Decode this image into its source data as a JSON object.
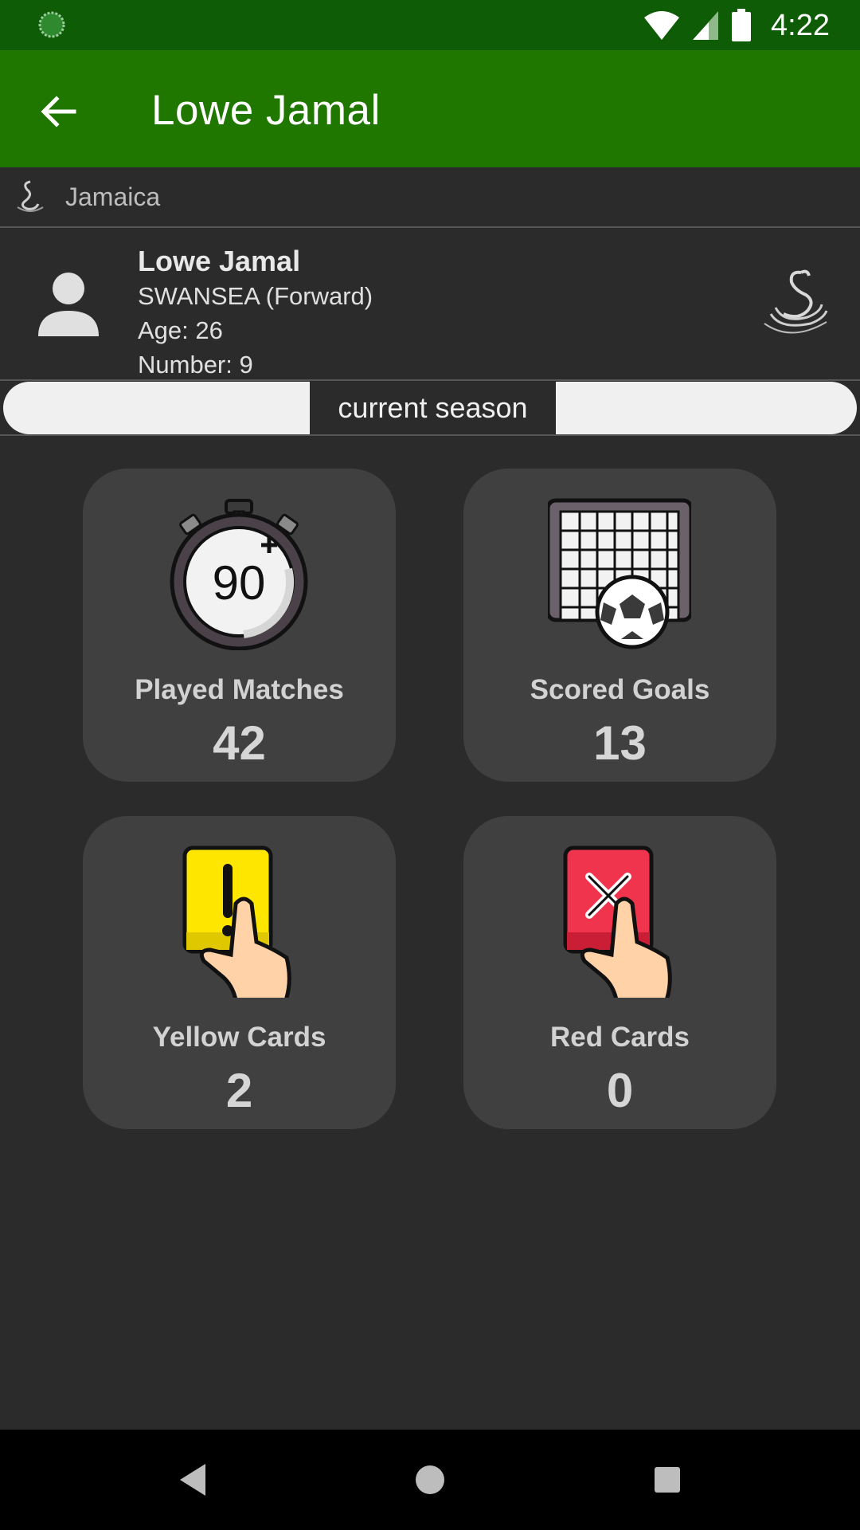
{
  "status_bar": {
    "time": "4:22",
    "icons": [
      "loading-icon",
      "wifi-icon",
      "signal-icon",
      "battery-icon"
    ]
  },
  "app_bar": {
    "title": "Lowe Jamal",
    "back_icon": "arrow-back-icon"
  },
  "country": {
    "name": "Jamaica",
    "icon": "swansea-badge-icon"
  },
  "player": {
    "name": "Lowe Jamal",
    "club_position": "SWANSEA  (Forward)",
    "age": "Age: 26",
    "number": "Number: 9",
    "avatar_icon": "person-icon",
    "club_logo_icon": "swansea-city-afc-logo"
  },
  "season": {
    "selected_label": "current season"
  },
  "stats": [
    {
      "label": "Played Matches",
      "value": "42",
      "icon": "stopwatch-90-icon"
    },
    {
      "label": "Scored Goals",
      "value": "13",
      "icon": "goal-net-ball-icon"
    },
    {
      "label": "Yellow Cards",
      "value": "2",
      "icon": "yellow-card-icon"
    },
    {
      "label": "Red Cards",
      "value": "0",
      "icon": "red-card-icon"
    }
  ],
  "colors": {
    "status_bar": "#0e5c06",
    "app_bar": "#1f7700",
    "background": "#2b2b2b",
    "tile": "#404040",
    "yellow_card": "#ffe600",
    "red_card": "#f0344d"
  },
  "nav_bar": {
    "icons": [
      "nav-back-icon",
      "nav-home-icon",
      "nav-recents-icon"
    ]
  }
}
